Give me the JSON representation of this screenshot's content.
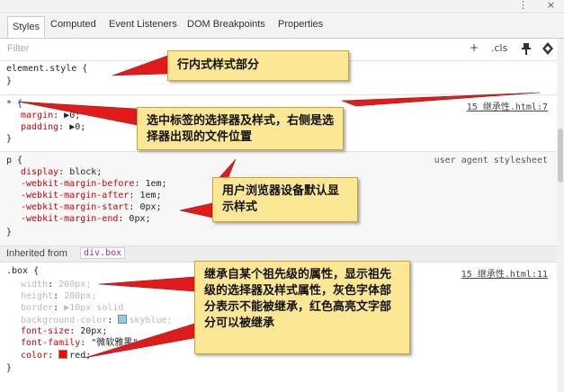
{
  "topbar": {
    "menu_icon": "⋮",
    "close_icon": "×"
  },
  "tabs": [
    "Styles",
    "Computed",
    "Event Listeners",
    "DOM Breakpoints",
    "Properties"
  ],
  "filter": {
    "placeholder": "Filter",
    "add_label": "+",
    "cls_label": ".cls",
    "pin_icon": "pin-icon",
    "paint_icon": "paint-icon"
  },
  "rules": {
    "element_style": {
      "selector": "element.style {",
      "close": "}"
    },
    "star": {
      "selector": "* {",
      "source": "15 继承性.html:7",
      "props": [
        {
          "name": "margin",
          "value": "▶0;"
        },
        {
          "name": "padding",
          "value": "▶0;"
        }
      ],
      "close": "}"
    },
    "p": {
      "selector": "p {",
      "source": "user agent stylesheet",
      "props": [
        {
          "name": "display",
          "value": "block;"
        },
        {
          "name": "-webkit-margin-before",
          "value": "1em;"
        },
        {
          "name": "-webkit-margin-after",
          "value": "1em;"
        },
        {
          "name": "-webkit-margin-start",
          "value": "0px;"
        },
        {
          "name": "-webkit-margin-end",
          "value": "0px;"
        }
      ],
      "close": "}"
    },
    "inherited": {
      "label": "Inherited from",
      "chip": "div.box"
    },
    "box": {
      "selector": ".box {",
      "source": "15 继承性.html:11",
      "props": [
        {
          "name": "width",
          "value": "200px;",
          "dim": true
        },
        {
          "name": "height",
          "value": "200px;",
          "dim": true
        },
        {
          "name": "border",
          "value": "▶10px solid",
          "dim": true
        },
        {
          "name": "background-color",
          "value": "skyblue;",
          "dim": true,
          "swatch": "#87ceeb"
        },
        {
          "name": "font-size",
          "value": "20px;",
          "dim": false
        },
        {
          "name": "font-family",
          "value": "\"微软雅黑\";",
          "dim": false
        },
        {
          "name": "color",
          "value": "red;",
          "dim": false,
          "swatch": "#ff0000"
        }
      ],
      "close": "}"
    }
  },
  "callouts": {
    "inline": "行内式样式部分",
    "selector": "选中标签的选择器及样式，右侧是选择器出现的文件位置",
    "ua": "用户浏览器设备默认显示样式",
    "inherited": "继承自某个祖先级的属性，显示祖先级的选择器及样式属性，灰色字体部分表示不能被继承，红色高亮文字部分可以被继承"
  },
  "colors": {
    "callout_bg": "#fbe794",
    "arrow": "#e11b1b",
    "property_name": "#c80000",
    "inherited_dim": "#b9b9b9"
  }
}
